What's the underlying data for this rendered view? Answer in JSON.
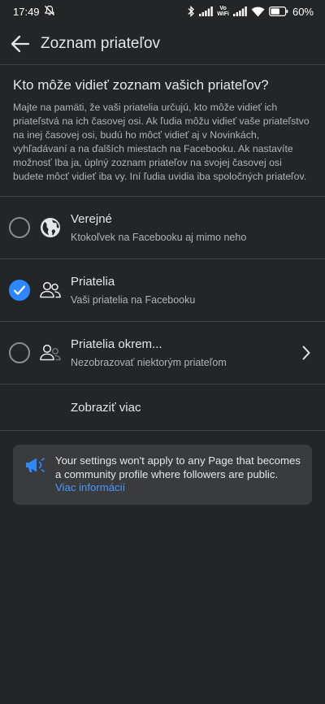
{
  "status_bar": {
    "time": "17:49",
    "vowifi_top": "Vo",
    "vowifi_bottom": "WiFi",
    "battery": "60%",
    "icons": [
      "mute-icon",
      "bluetooth-icon",
      "signal-icon",
      "wifi-icon",
      "battery-icon"
    ]
  },
  "header": {
    "title": "Zoznam priateľov",
    "back_icon": "arrow-left-icon"
  },
  "intro": {
    "title": "Kto môže vidieť zoznam vašich priateľov?",
    "text": "Majte na pamäti, že vaši priatelia určujú, kto môže vidieť ich priateľstvá na ich časovej osi. Ak ľudia môžu vidieť vaše priateľstvo na inej časovej osi, budú ho môcť vidieť aj v Novinkách, vyhľadávaní a na ďalších miestach na Facebooku. Ak nastavíte možnosť Iba ja, úplný zoznam priateľov na svojej časovej osi budete môcť vidieť iba vy. Iní ľudia uvidia iba spoločných priateľov."
  },
  "options": [
    {
      "title": "Verejné",
      "subtitle": "Ktokoľvek na Facebooku aj mimo neho",
      "icon": "globe-icon",
      "selected": false
    },
    {
      "title": "Priatelia",
      "subtitle": "Vaši priatelia na Facebooku",
      "icon": "friends-icon",
      "selected": true
    },
    {
      "title": "Priatelia okrem...",
      "subtitle": "Nezobrazovať niektorým priateľom",
      "icon": "friends-except-icon",
      "selected": false,
      "has_chevron": true
    }
  ],
  "more_label": "Zobraziť viac",
  "notice": {
    "icon": "megaphone-icon",
    "text": "Your settings won't apply to any Page that becomes a community profile where followers are public. ",
    "link": "Viac informácií"
  },
  "colors": {
    "background": "#242526",
    "card": "#3a3b3c",
    "accent": "#2d88ff",
    "link": "#4599ff"
  }
}
